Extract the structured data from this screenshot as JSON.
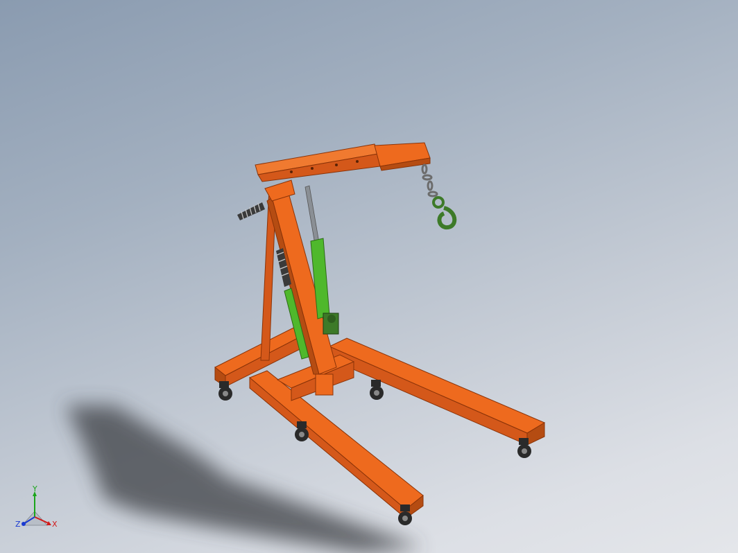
{
  "viewport": {
    "background_top": "#8a9bb0",
    "background_bottom": "#e4e6ea"
  },
  "model": {
    "name": "engine-crane",
    "frame_color": "#ee6a1e",
    "frame_edge_color": "#8a3308",
    "cylinder_color": "#4fb82c",
    "rod_color": "#8a8f95",
    "chain_color": "#6c6c6c",
    "hook_color": "#3d7a28",
    "wheel_color": "#2a2a2a"
  },
  "triad": {
    "x_label": "X",
    "y_label": "Y",
    "z_label": "Z",
    "x_color": "#d11a1a",
    "y_color": "#1aa51a",
    "z_color": "#1a3ad1"
  }
}
